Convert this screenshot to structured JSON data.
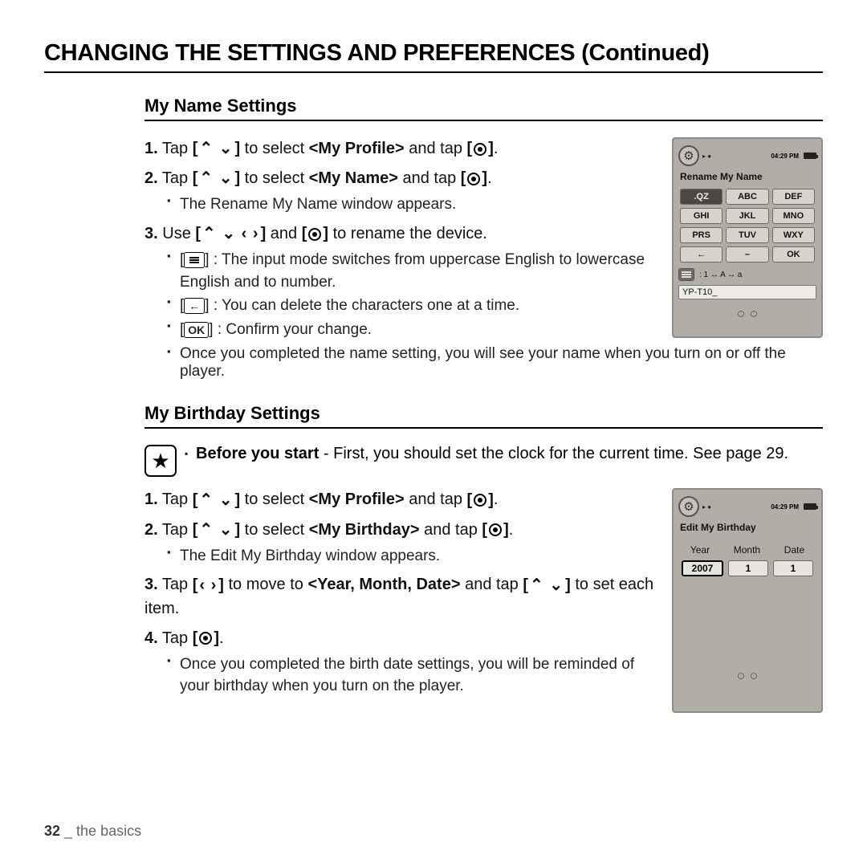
{
  "page_title": "CHANGING THE SETTINGS AND PREFERENCES (Continued)",
  "section1": {
    "title": "My Name Settings",
    "step1_a": "Tap ",
    "step1_b": " to select ",
    "step1_target": "<My Profile>",
    "step1_c": " and tap ",
    "step2_a": "Tap ",
    "step2_b": " to select ",
    "step2_target": "<My Name>",
    "step2_c": " and tap ",
    "sub2_1": "The Rename My Name window appears.",
    "step3_a": "Use ",
    "step3_b": " and ",
    "step3_c": " to rename the device.",
    "sub3_1": " : The input mode switches from uppercase English to lowercase English and to number.",
    "sub3_2": " : You can delete the characters one at a time.",
    "sub3_3": " : Confirm your change.",
    "sub3_4": "Once you completed the name setting, you will see your name when you turn on or off the player."
  },
  "section2": {
    "title": "My Birthday Settings",
    "before_bold": "Before you start",
    "before_rest": " - First, you should set the clock for the current time. See page 29.",
    "step1_a": "Tap ",
    "step1_b": " to select ",
    "step1_target": "<My Profile>",
    "step1_c": " and tap ",
    "step2_a": "Tap ",
    "step2_b": " to select ",
    "step2_target": "<My Birthday>",
    "step2_c": " and tap ",
    "sub2_1": "The Edit My Birthday window appears.",
    "step3_a": "Tap ",
    "step3_b": " to move to ",
    "step3_targets": "<Year, Month, Date>",
    "step3_c": " and tap ",
    "step3_d": " to set each item.",
    "step4_a": "Tap ",
    "sub4_1": "Once you completed the birth date settings, you will be reminded of your birthday when you turn on the player."
  },
  "glyphs": {
    "updown": "⌃ ⌄",
    "updownlr": "⌃ ⌄ ‹ ›",
    "lr": "‹  ›",
    "ok": "OK",
    "back": "←"
  },
  "device1": {
    "time": "04:29 PM",
    "title": "Rename My Name",
    "keys": [
      ".QZ",
      "ABC",
      "DEF",
      "GHI",
      "JKL",
      "MNO",
      "PRS",
      "TUV",
      "WXY",
      "←",
      "–",
      "OK"
    ],
    "mode": ": 1 ↔ A ↔ a",
    "name_value": "YP-T10_"
  },
  "device2": {
    "time": "04:29 PM",
    "title": "Edit My Birthday",
    "cols": [
      "Year",
      "Month",
      "Date"
    ],
    "vals": [
      "2007",
      "1",
      "1"
    ]
  },
  "footer": {
    "page": "32",
    "sep": " _ ",
    "chapter": "the basics"
  }
}
